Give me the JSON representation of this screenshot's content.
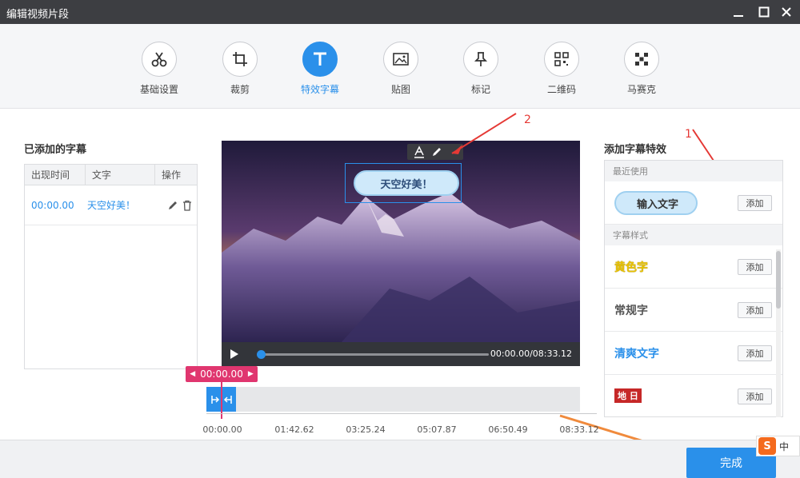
{
  "window": {
    "title": "编辑视频片段"
  },
  "toolbar": {
    "tools": [
      {
        "label": "基础设置",
        "icon": "scissors-icon"
      },
      {
        "label": "裁剪",
        "icon": "crop-icon"
      },
      {
        "label": "特效字幕",
        "icon": "text-t-icon",
        "active": true
      },
      {
        "label": "贴图",
        "icon": "image-icon"
      },
      {
        "label": "标记",
        "icon": "pin-icon"
      },
      {
        "label": "二维码",
        "icon": "qrcode-icon"
      },
      {
        "label": "马赛克",
        "icon": "mosaic-icon"
      }
    ]
  },
  "subtitles_panel": {
    "title": "已添加的字幕",
    "columns": [
      "出现时间",
      "文字",
      "操作"
    ],
    "rows": [
      {
        "time": "00:00.00",
        "text": "天空好美！"
      }
    ]
  },
  "preview": {
    "overlay_text": "天空好美！",
    "time_readout": "00:00.00/08:33.12",
    "progress_fraction": 0.0
  },
  "timeline": {
    "current_time": "00:00.00",
    "ticks": [
      "00:00.00",
      "01:42.62",
      "03:25.24",
      "05:07.87",
      "06:50.49",
      "08:33.12"
    ]
  },
  "effects_panel": {
    "title": "添加字幕特效",
    "section_recent": "最近使用",
    "section_styles": "字幕样式",
    "add_label": "添加",
    "items": [
      {
        "sample": "输入文字",
        "color": "#2a90ea"
      },
      {
        "sample": "黄色字",
        "color": "#e8c200"
      },
      {
        "sample": "常规字",
        "color": "#555555"
      },
      {
        "sample": "清爽文字",
        "color": "#2a90ea"
      },
      {
        "sample": "地 日",
        "color": "#c62828"
      }
    ]
  },
  "footer": {
    "done_label": "完成"
  },
  "annotations": {
    "num1": "1",
    "num2": "2"
  },
  "ime": {
    "logo": "S",
    "label": "中"
  },
  "colors": {
    "accent": "#2a90ea",
    "timeline_marker": "#e0366f",
    "titlebar": "#3d3e42"
  }
}
